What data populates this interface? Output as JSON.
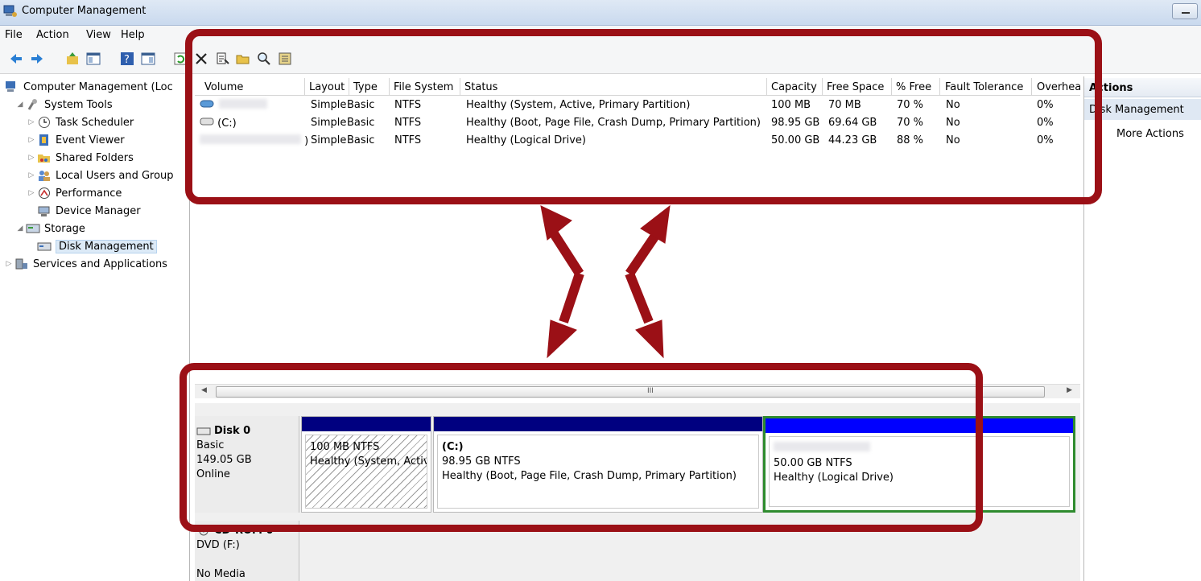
{
  "window": {
    "title": "Computer Management"
  },
  "menu": [
    "File",
    "Action",
    "View",
    "Help"
  ],
  "tree": {
    "root": "Computer Management (Loc",
    "system_tools": "System Tools",
    "task_scheduler": "Task Scheduler",
    "event_viewer": "Event Viewer",
    "shared_folders": "Shared Folders",
    "local_users": "Local Users and Group",
    "performance": "Performance",
    "device_manager": "Device Manager",
    "storage": "Storage",
    "disk_management": "Disk Management",
    "services": "Services and Applications"
  },
  "volumes": {
    "columns": [
      "Volume",
      "Layout",
      "Type",
      "File System",
      "Status",
      "Capacity",
      "Free Space",
      "% Free",
      "Fault Tolerance",
      "Overhea"
    ],
    "rows": [
      {
        "volume": "",
        "layout": "Simple",
        "type": "Basic",
        "fs": "NTFS",
        "status": "Healthy (System, Active, Primary Partition)",
        "capacity": "100 MB",
        "free": "70 MB",
        "pct": "70 %",
        "fault": "No",
        "overhead": "0%"
      },
      {
        "volume": "(C:)",
        "layout": "Simple",
        "type": "Basic",
        "fs": "NTFS",
        "status": "Healthy (Boot, Page File, Crash Dump, Primary Partition)",
        "capacity": "98.95 GB",
        "free": "69.64 GB",
        "pct": "70 %",
        "fault": "No",
        "overhead": "0%"
      },
      {
        "volume": ")",
        "layout": "Simple",
        "type": "Basic",
        "fs": "NTFS",
        "status": "Healthy (Logical Drive)",
        "capacity": "50.00 GB",
        "free": "44.23 GB",
        "pct": "88 %",
        "fault": "No",
        "overhead": "0%"
      }
    ]
  },
  "scrollbar": {
    "grip": "III"
  },
  "disk0": {
    "name": "Disk 0",
    "type": "Basic",
    "size": "149.05 GB",
    "state": "Online",
    "partitions": [
      {
        "label": "",
        "size": "100 MB NTFS",
        "status": "Healthy (System, Activ"
      },
      {
        "label": "(C:)",
        "size": "98.95 GB NTFS",
        "status": "Healthy (Boot, Page File, Crash Dump, Primary Partition)"
      },
      {
        "label": "",
        "size": "50.00 GB NTFS",
        "status": "Healthy (Logical Drive)"
      }
    ]
  },
  "cdrom": {
    "name": "CD-ROM 0",
    "drive": "DVD (F:)",
    "media": "No Media"
  },
  "actions": {
    "header": "Actions",
    "section": "Disk Management",
    "more": "More Actions"
  },
  "colors": {
    "annotation": "#9b1016",
    "primary_bar": "#000080",
    "logical_bar": "#0000ff",
    "logical_border": "#2e8b2e"
  }
}
